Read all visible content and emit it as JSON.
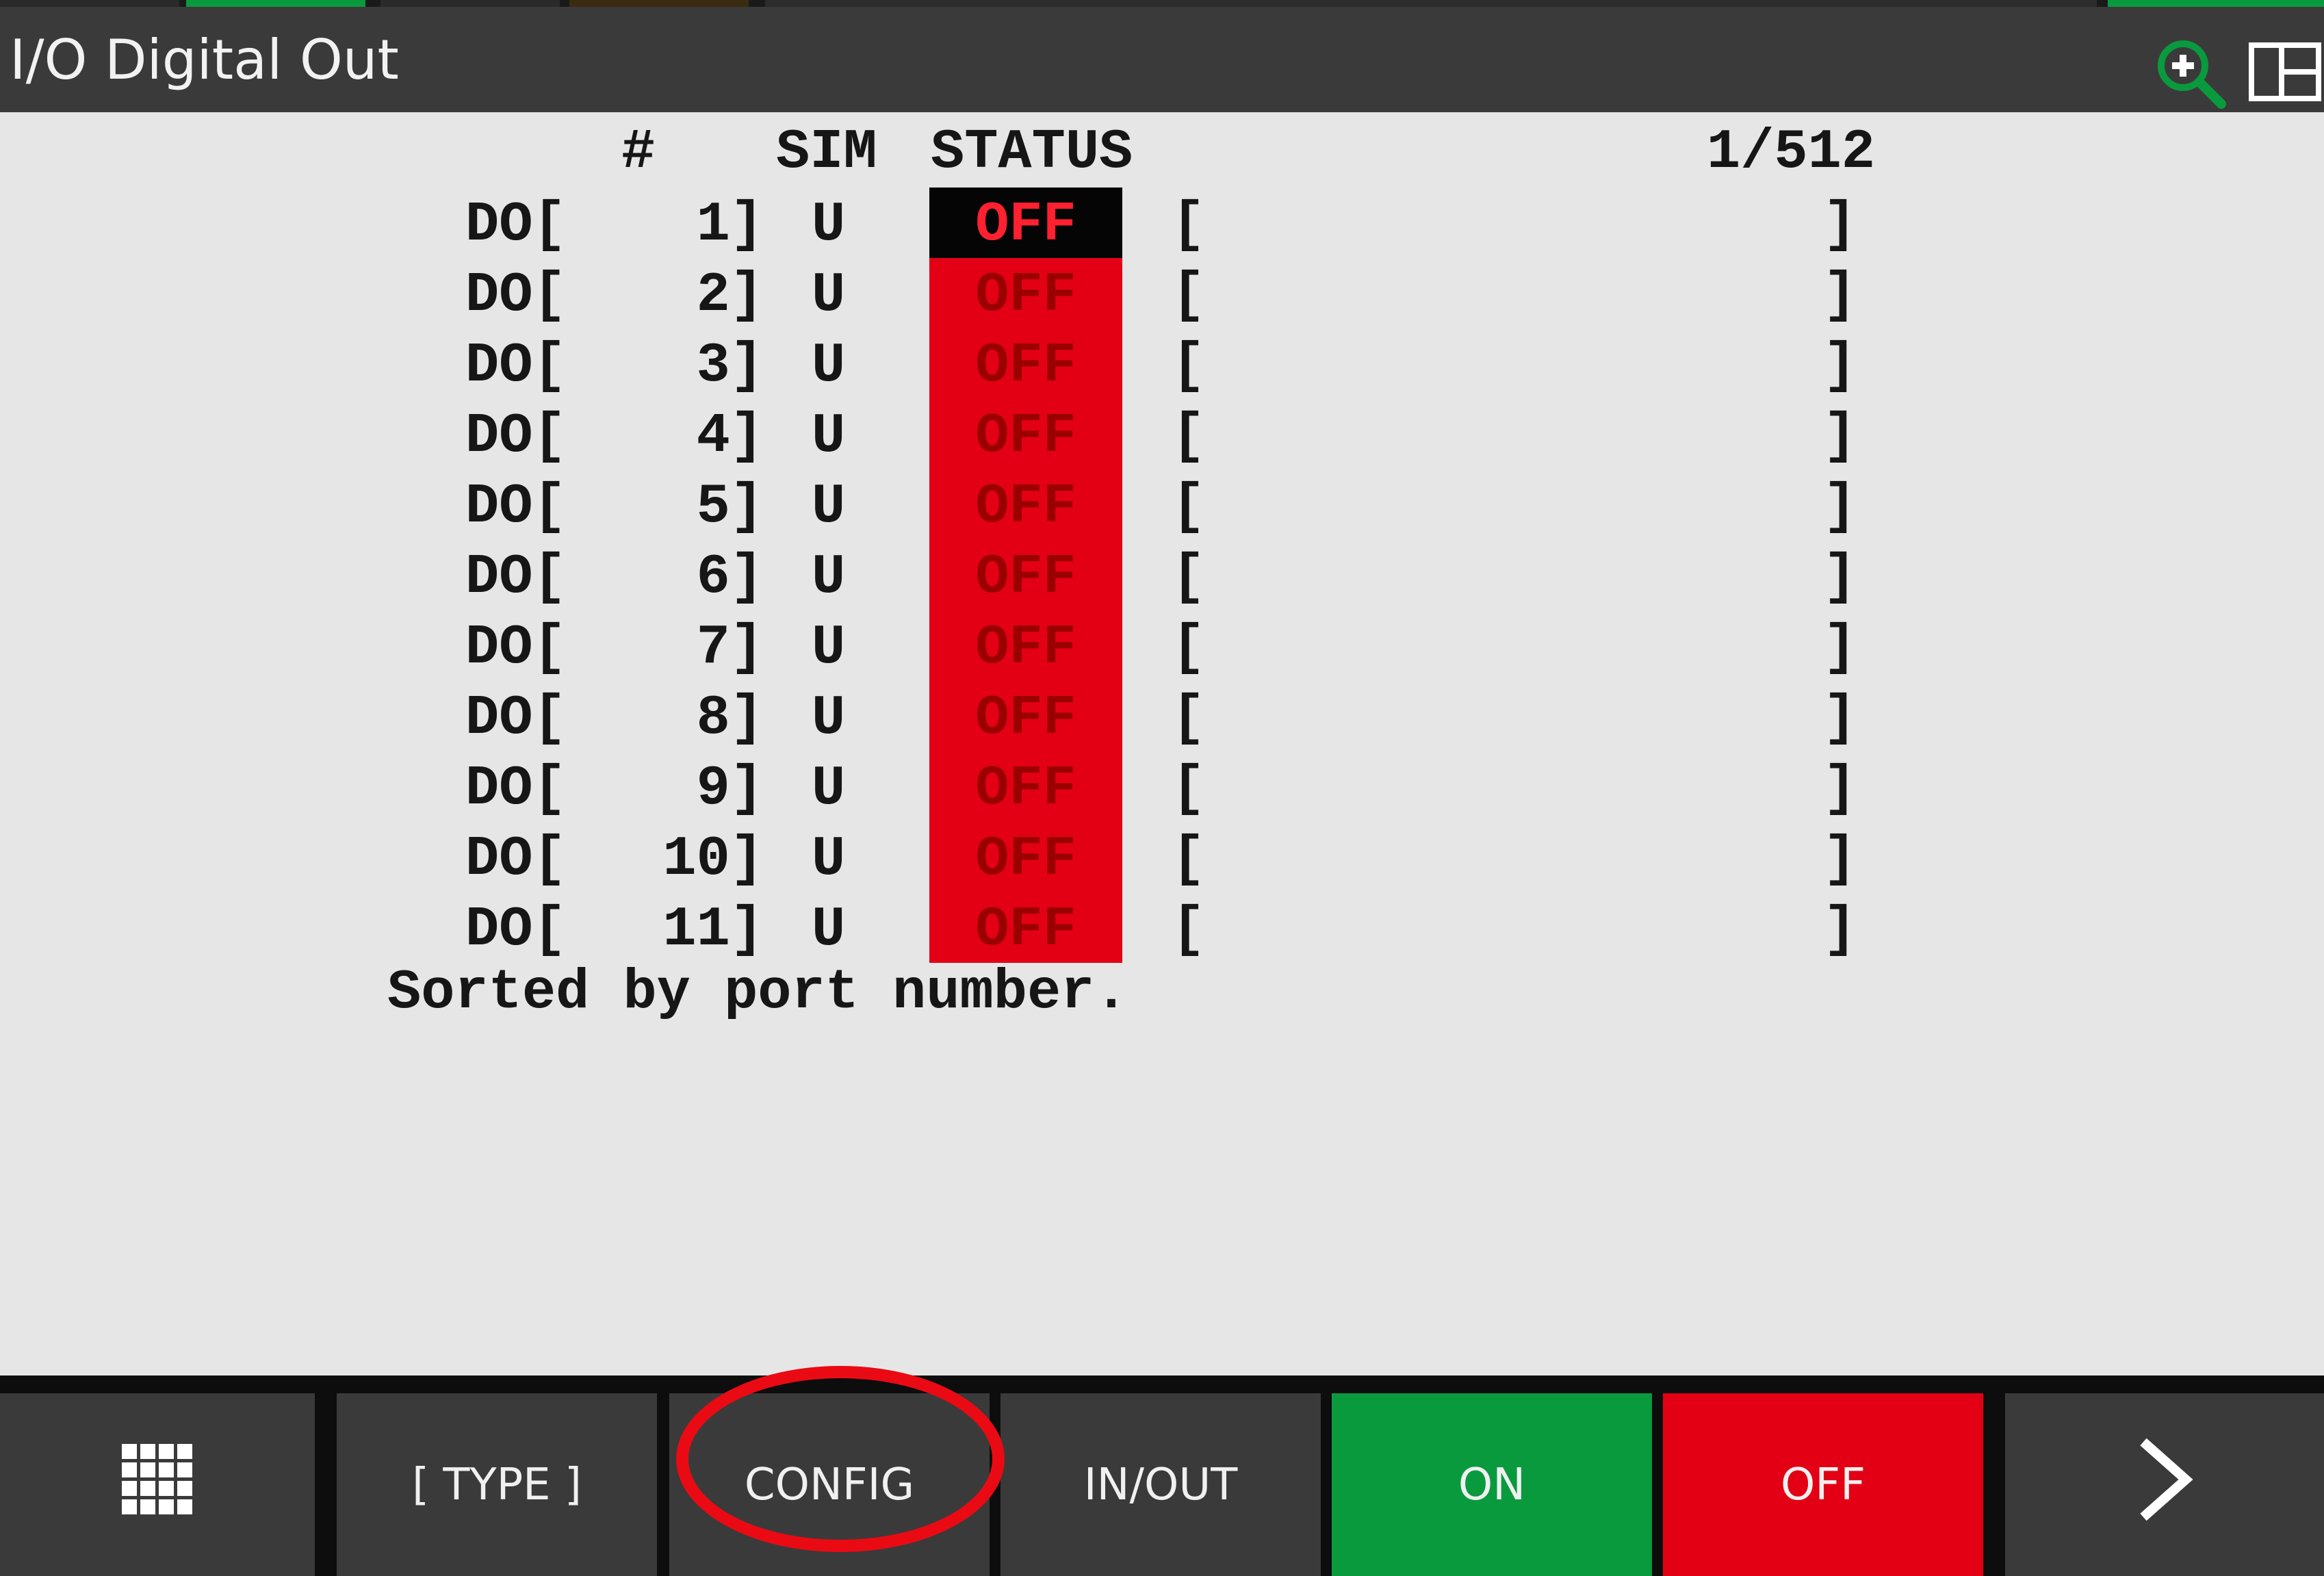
{
  "header": {
    "title": "I/O Digital Out",
    "zoom_icon": "zoom-in-icon",
    "layout_icon": "split-layout-icon"
  },
  "table": {
    "col_number": "#",
    "col_sim": "SIM",
    "col_status": "STATUS",
    "position": "1/512",
    "rows": [
      {
        "prefix": "DO[",
        "index": "1]",
        "sim": "U",
        "status": "OFF",
        "comment_open": "[",
        "comment_close": "]",
        "selected": true
      },
      {
        "prefix": "DO[",
        "index": "2]",
        "sim": "U",
        "status": "OFF",
        "comment_open": "[",
        "comment_close": "]"
      },
      {
        "prefix": "DO[",
        "index": "3]",
        "sim": "U",
        "status": "OFF",
        "comment_open": "[",
        "comment_close": "]"
      },
      {
        "prefix": "DO[",
        "index": "4]",
        "sim": "U",
        "status": "OFF",
        "comment_open": "[",
        "comment_close": "]"
      },
      {
        "prefix": "DO[",
        "index": "5]",
        "sim": "U",
        "status": "OFF",
        "comment_open": "[",
        "comment_close": "]"
      },
      {
        "prefix": "DO[",
        "index": "6]",
        "sim": "U",
        "status": "OFF",
        "comment_open": "[",
        "comment_close": "]"
      },
      {
        "prefix": "DO[",
        "index": "7]",
        "sim": "U",
        "status": "OFF",
        "comment_open": "[",
        "comment_close": "]"
      },
      {
        "prefix": "DO[",
        "index": "8]",
        "sim": "U",
        "status": "OFF",
        "comment_open": "[",
        "comment_close": "]"
      },
      {
        "prefix": "DO[",
        "index": "9]",
        "sim": "U",
        "status": "OFF",
        "comment_open": "[",
        "comment_close": "]"
      },
      {
        "prefix": "DO[",
        "index": "10]",
        "sim": "U",
        "status": "OFF",
        "comment_open": "[",
        "comment_close": "]"
      },
      {
        "prefix": "DO[",
        "index": "11]",
        "sim": "U",
        "status": "OFF",
        "comment_open": "[",
        "comment_close": "]"
      }
    ],
    "footer": "Sorted by port number."
  },
  "function_keys": {
    "menu_icon": "grid-menu-icon",
    "type": "[ TYPE ]",
    "config": "CONFIG",
    "in_out": "IN/OUT",
    "on": "ON",
    "off": "OFF",
    "next_icon": "chevron-right-icon"
  },
  "colors": {
    "status_off": "#e30014",
    "on_key": "#0a9a3e",
    "off_key": "#e30014",
    "highlight": "#ea0a14"
  }
}
